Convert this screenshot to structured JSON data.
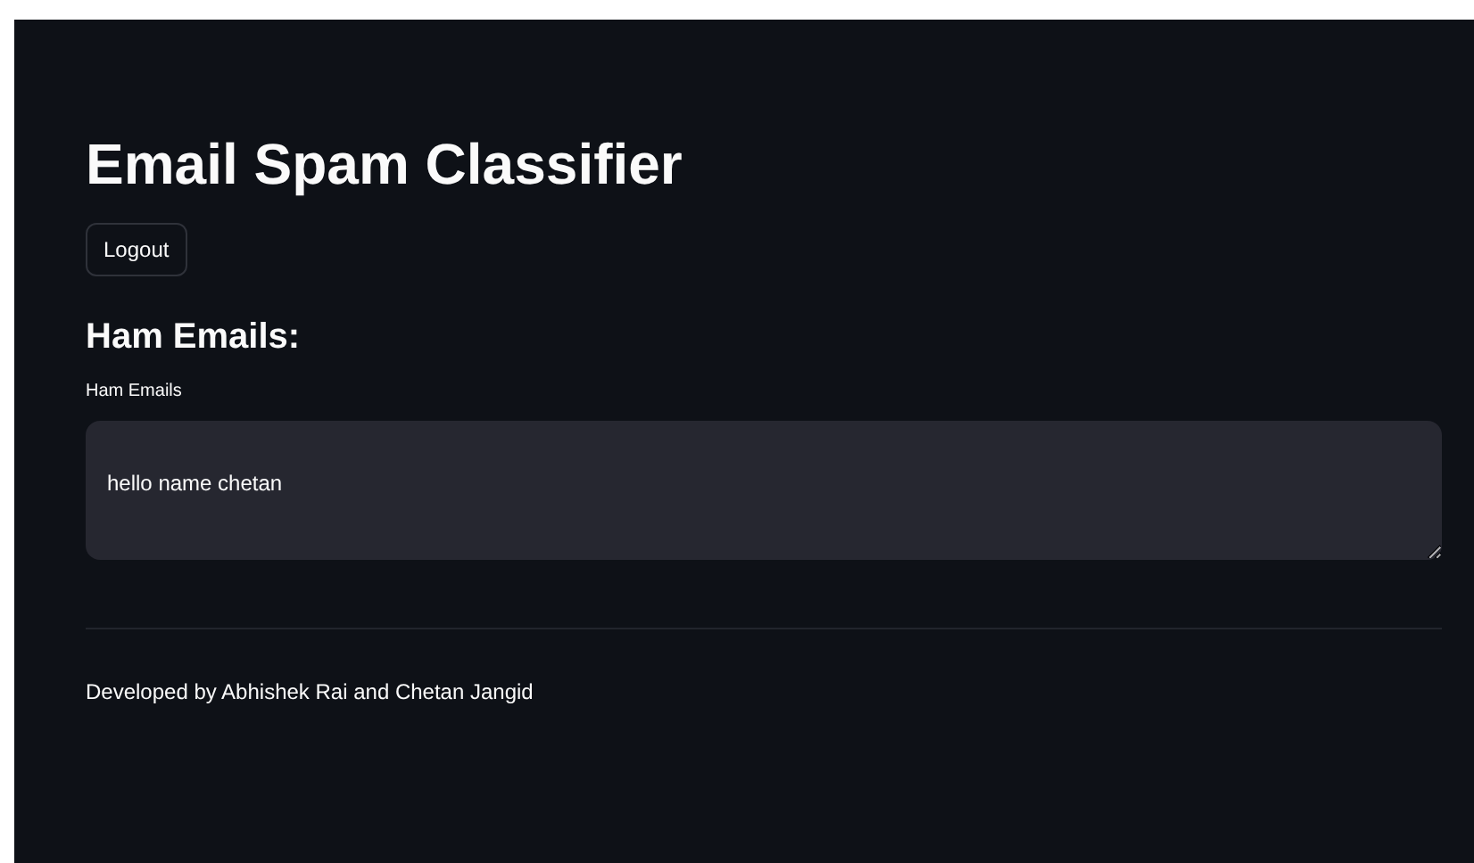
{
  "title": "Email Spam Classifier",
  "logout_button": {
    "label": "Logout"
  },
  "section_heading": "Ham Emails:",
  "text_area": {
    "label": "Ham Emails",
    "value": "hello name chetan"
  },
  "footer": "Developed by Abhishek Rai and Chetan Jangid"
}
